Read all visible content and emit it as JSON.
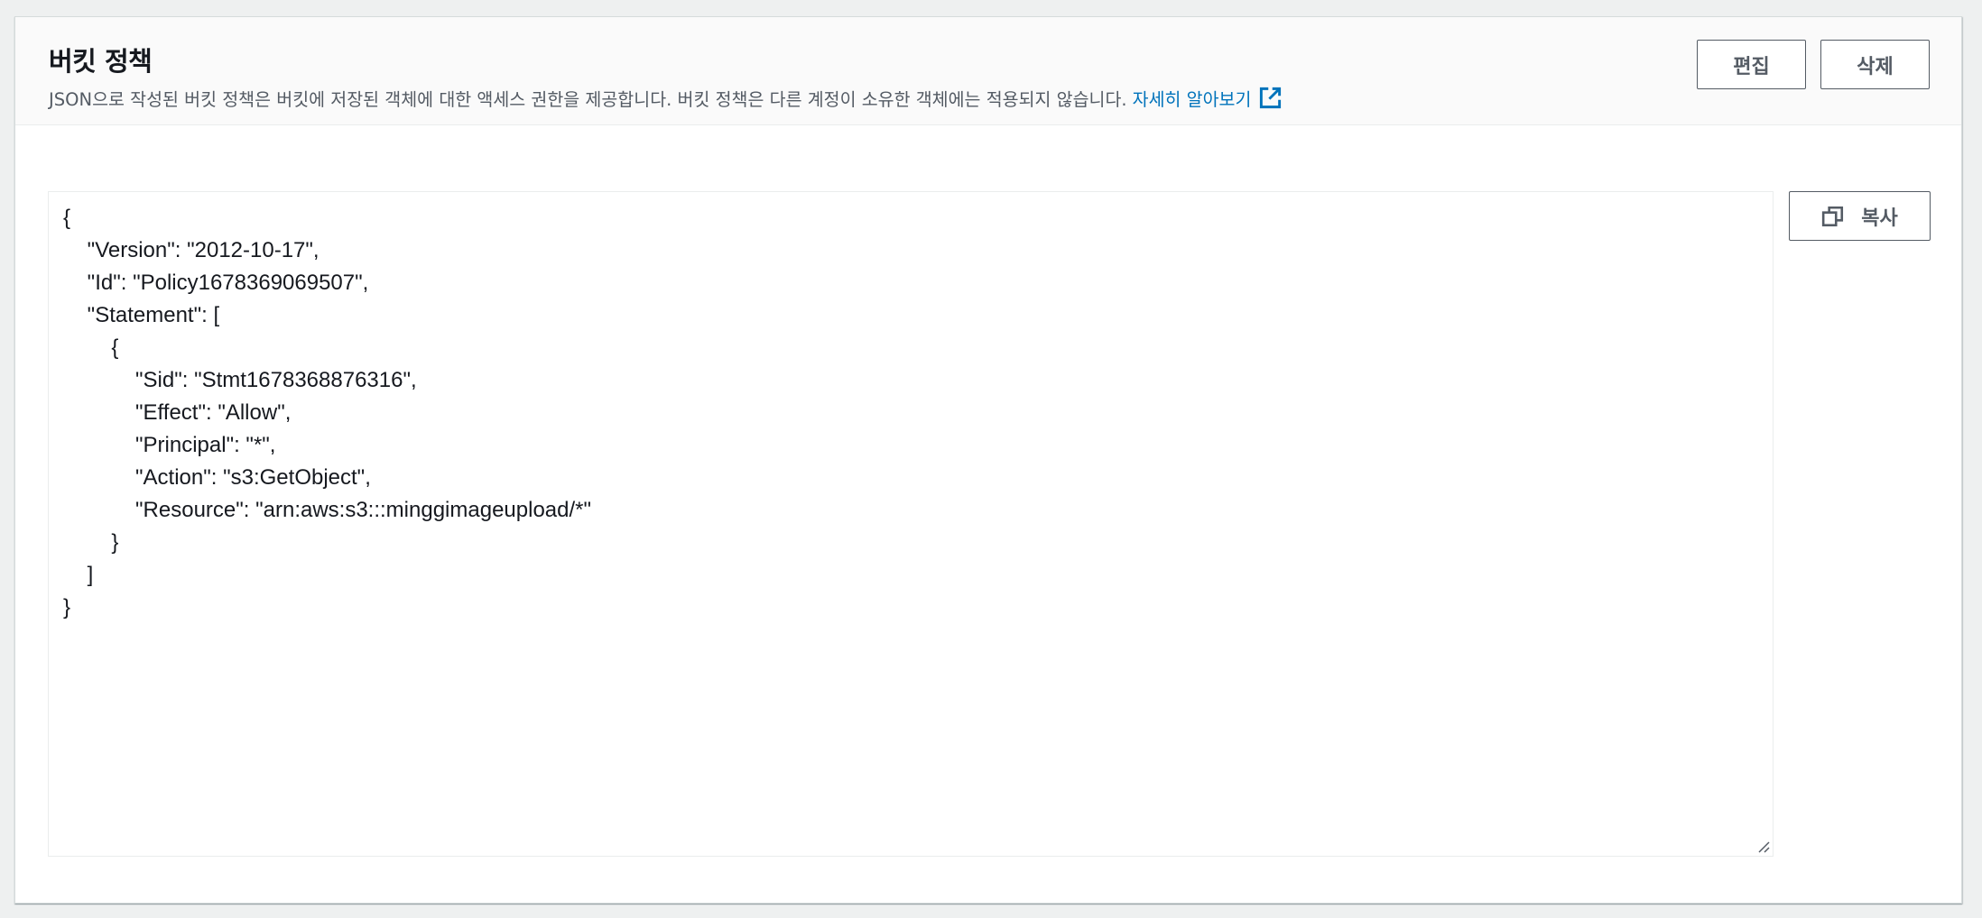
{
  "panel": {
    "title": "버킷 정책",
    "description": "JSON으로 작성된 버킷 정책은 버킷에 저장된 객체에 대한 액세스 권한을 제공합니다. 버킷 정책은 다른 계정이 소유한 객체에는 적용되지 않습니다.",
    "learn_more_label": "자세히 알아보기",
    "learn_more_icon": "external-link-icon"
  },
  "actions": {
    "edit_label": "편집",
    "delete_label": "삭제",
    "copy_label": "복사",
    "copy_icon": "copy-icon"
  },
  "policy": {
    "lines": [
      "{",
      "    \"Version\": \"2012-10-17\",",
      "    \"Id\": \"Policy1678369069507\",",
      "    \"Statement\": [",
      "        {",
      "            \"Sid\": \"Stmt1678368876316\",",
      "            \"Effect\": \"Allow\",",
      "            \"Principal\": \"*\",",
      "            \"Action\": \"s3:GetObject\",",
      "            \"Resource\": \"arn:aws:s3:::minggimageupload/*\"",
      "        }",
      "    ]",
      "}"
    ]
  },
  "colors": {
    "link": "#0073bb",
    "text": "#16191f",
    "muted": "#545b64",
    "header_bg": "#fafafa",
    "page_bg": "#eef0f0"
  }
}
